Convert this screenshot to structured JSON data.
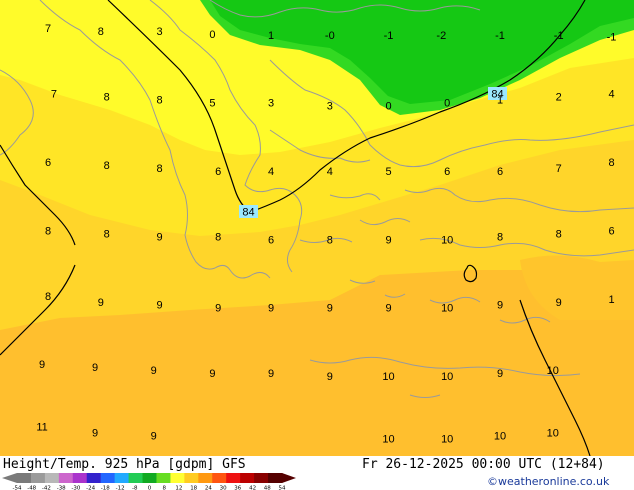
{
  "map": {
    "contour_label": "84",
    "temperature_labels": [
      {
        "t": "7",
        "lon": -0.5,
        "lat": 0.1
      },
      {
        "t": "8",
        "lon": 0.4,
        "lat": 0.05
      },
      {
        "t": "3",
        "lon": 1.4,
        "lat": 0.05
      },
      {
        "t": "0",
        "lon": 2.3,
        "lat": 0.0
      },
      {
        "t": "1",
        "lon": 3.3,
        "lat": -0.02
      },
      {
        "t": "-0",
        "lon": 4.3,
        "lat": -0.02
      },
      {
        "t": "-1",
        "lon": 5.3,
        "lat": -0.02
      },
      {
        "t": "-2",
        "lon": 6.2,
        "lat": -0.02
      },
      {
        "t": "-1",
        "lon": 7.2,
        "lat": -0.02
      },
      {
        "t": "-1",
        "lon": 8.2,
        "lat": -0.02
      },
      {
        "t": "-1",
        "lon": 9.1,
        "lat": -0.04
      },
      {
        "t": "7",
        "lon": -0.4,
        "lat": -1.0
      },
      {
        "t": "8",
        "lon": 0.5,
        "lat": -1.05
      },
      {
        "t": "8",
        "lon": 1.4,
        "lat": -1.1
      },
      {
        "t": "5",
        "lon": 2.3,
        "lat": -1.15
      },
      {
        "t": "3",
        "lon": 3.3,
        "lat": -1.15
      },
      {
        "t": "3",
        "lon": 4.3,
        "lat": -1.2
      },
      {
        "t": "0",
        "lon": 5.3,
        "lat": -1.2
      },
      {
        "t": "0",
        "lon": 6.3,
        "lat": -1.15
      },
      {
        "t": "1",
        "lon": 7.2,
        "lat": -1.1
      },
      {
        "t": "2",
        "lon": 8.2,
        "lat": -1.05
      },
      {
        "t": "4",
        "lon": 9.1,
        "lat": -1.0
      },
      {
        "t": "6",
        "lon": -0.5,
        "lat": -2.15
      },
      {
        "t": "8",
        "lon": 0.5,
        "lat": -2.2
      },
      {
        "t": "8",
        "lon": 1.4,
        "lat": -2.25
      },
      {
        "t": "6",
        "lon": 2.4,
        "lat": -2.3
      },
      {
        "t": "4",
        "lon": 3.3,
        "lat": -2.3
      },
      {
        "t": "4",
        "lon": 4.3,
        "lat": -2.3
      },
      {
        "t": "5",
        "lon": 5.3,
        "lat": -2.3
      },
      {
        "t": "6",
        "lon": 6.3,
        "lat": -2.3
      },
      {
        "t": "6",
        "lon": 7.2,
        "lat": -2.3
      },
      {
        "t": "7",
        "lon": 8.2,
        "lat": -2.25
      },
      {
        "t": "8",
        "lon": 9.1,
        "lat": -2.15
      },
      {
        "t": "8",
        "lon": -0.5,
        "lat": -3.3
      },
      {
        "t": "8",
        "lon": 0.5,
        "lat": -3.35
      },
      {
        "t": "9",
        "lon": 1.4,
        "lat": -3.4
      },
      {
        "t": "8",
        "lon": 2.4,
        "lat": -3.4
      },
      {
        "t": "6",
        "lon": 3.3,
        "lat": -3.45
      },
      {
        "t": "8",
        "lon": 4.3,
        "lat": -3.45
      },
      {
        "t": "9",
        "lon": 5.3,
        "lat": -3.45
      },
      {
        "t": "10",
        "lon": 6.3,
        "lat": -3.45
      },
      {
        "t": "8",
        "lon": 7.2,
        "lat": -3.4
      },
      {
        "t": "8",
        "lon": 8.2,
        "lat": -3.35
      },
      {
        "t": "6",
        "lon": 9.1,
        "lat": -3.3
      },
      {
        "t": "8",
        "lon": -0.5,
        "lat": -4.4
      },
      {
        "t": "9",
        "lon": 0.4,
        "lat": -4.5
      },
      {
        "t": "9",
        "lon": 1.4,
        "lat": -4.55
      },
      {
        "t": "9",
        "lon": 2.4,
        "lat": -4.6
      },
      {
        "t": "9",
        "lon": 3.3,
        "lat": -4.6
      },
      {
        "t": "9",
        "lon": 4.3,
        "lat": -4.6
      },
      {
        "t": "9",
        "lon": 5.3,
        "lat": -4.6
      },
      {
        "t": "10",
        "lon": 6.3,
        "lat": -4.6
      },
      {
        "t": "9",
        "lon": 7.2,
        "lat": -4.55
      },
      {
        "t": "9",
        "lon": 8.2,
        "lat": -4.5
      },
      {
        "t": "1",
        "lon": 9.1,
        "lat": -4.45
      },
      {
        "t": "9",
        "lon": -0.6,
        "lat": -5.55
      },
      {
        "t": "9",
        "lon": 0.3,
        "lat": -5.6
      },
      {
        "t": "9",
        "lon": 1.3,
        "lat": -5.65
      },
      {
        "t": "9",
        "lon": 2.3,
        "lat": -5.7
      },
      {
        "t": "9",
        "lon": 3.3,
        "lat": -5.7
      },
      {
        "t": "9",
        "lon": 4.3,
        "lat": -5.75
      },
      {
        "t": "10",
        "lon": 5.3,
        "lat": -5.75
      },
      {
        "t": "10",
        "lon": 6.3,
        "lat": -5.75
      },
      {
        "t": "9",
        "lon": 7.2,
        "lat": -5.7
      },
      {
        "t": "10",
        "lon": 8.1,
        "lat": -5.65
      },
      {
        "t": "11",
        "lon": -0.6,
        "lat": -6.6
      },
      {
        "t": "9",
        "lon": 0.3,
        "lat": -6.7
      },
      {
        "t": "9",
        "lon": 1.3,
        "lat": -6.75
      },
      {
        "t": "10",
        "lon": 5.3,
        "lat": -6.8
      },
      {
        "t": "10",
        "lon": 6.3,
        "lat": -6.8
      },
      {
        "t": "10",
        "lon": 7.2,
        "lat": -6.75
      },
      {
        "t": "10",
        "lon": 8.1,
        "lat": -6.7
      }
    ]
  },
  "footer": {
    "title": "Height/Temp. 925 hPa [gdpm] GFS",
    "date": "Fr 26-12-2025 00:00 UTC (12+84)",
    "credit": "©weatheronline.co.uk",
    "scale_ticks": [
      "-54",
      "-48",
      "-42",
      "-38",
      "-30",
      "-24",
      "-18",
      "-12",
      "-8",
      "0",
      "8",
      "12",
      "18",
      "24",
      "30",
      "36",
      "42",
      "48",
      "54"
    ],
    "scale_colors": [
      "#7a7a7a",
      "#9a9a9a",
      "#b8b8b8",
      "#cc66cc",
      "#aa33cc",
      "#3322cc",
      "#2266ff",
      "#22aaff",
      "#22cc55",
      "#11aa22",
      "#66dd22",
      "#ffff33",
      "#ffcc22",
      "#ff9911",
      "#ff5511",
      "#ee1111",
      "#bb0000",
      "#880000",
      "#550000"
    ]
  },
  "colors": {
    "green": "#15c814",
    "lightgreen": "#33d922",
    "yellow": "#fffb2a",
    "yellow2": "#ffe31f",
    "amber": "#ffd22b",
    "orange": "#ffbd2d",
    "coast": "#9a9a9a",
    "contour": "#000000"
  }
}
